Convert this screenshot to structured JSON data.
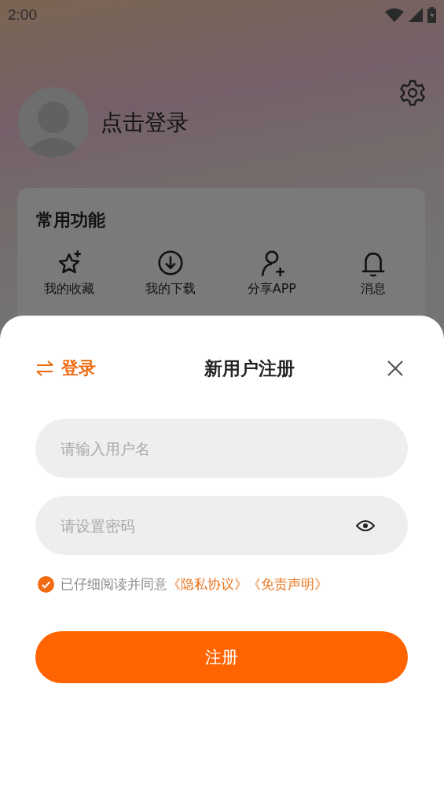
{
  "status_bar": {
    "time": "2:00"
  },
  "profile": {
    "name": "点击登录"
  },
  "functions": {
    "title": "常用功能",
    "items": [
      {
        "label": "我的收藏",
        "kind": "star"
      },
      {
        "label": "我的下载",
        "kind": "download"
      },
      {
        "label": "分享APP",
        "kind": "add-user"
      },
      {
        "label": "消息",
        "kind": "bell"
      }
    ]
  },
  "sheet": {
    "switch_label": "登录",
    "title": "新用户注册",
    "fields": [
      {
        "placeholder": "请输入用户名",
        "kind": "text"
      },
      {
        "placeholder": "请设置密码",
        "kind": "password"
      }
    ],
    "agreement": {
      "checked": true,
      "text": "已仔细阅读并同意",
      "links": [
        "《隐私协议》",
        "《免责声明》"
      ]
    },
    "submit": "注册"
  }
}
